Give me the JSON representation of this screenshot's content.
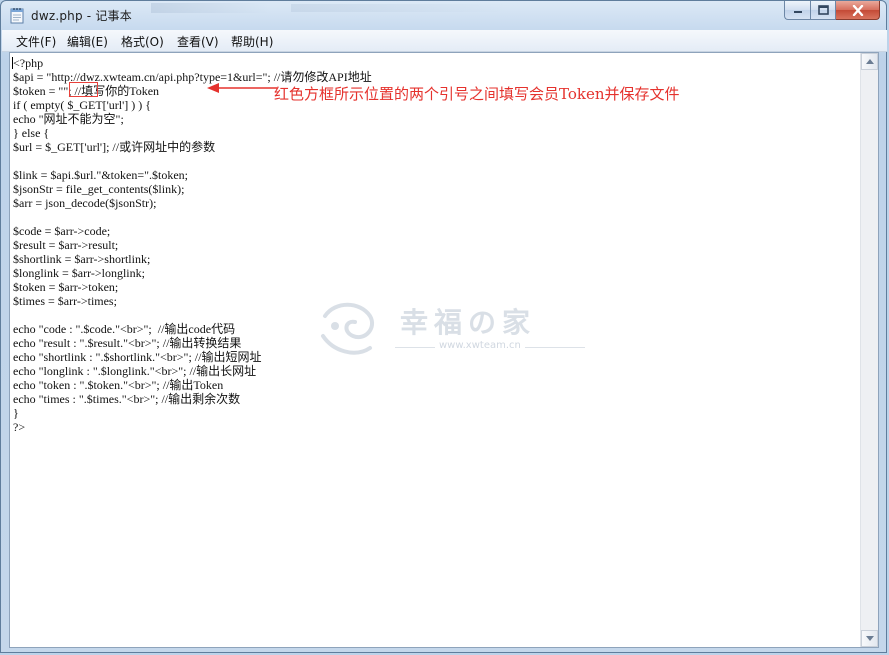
{
  "window": {
    "title": "dwz.php - 记事本"
  },
  "menu": [
    "文件(F)",
    "编辑(E)",
    "格式(O)",
    "查看(V)",
    "帮助(H)"
  ],
  "code_lines": [
    "<?php",
    "$api = \"http://dwz.xwteam.cn/api.php?type=1&url=\"; //请勿修改API地址",
    "$token = \"\"; //填写你的Token",
    "if ( empty( $_GET['url'] ) ) {",
    "echo \"网址不能为空\";",
    "} else {",
    "$url = $_GET['url']; //或许网址中的参数",
    "",
    "$link = $api.$url.\"&token=\".$token;",
    "$jsonStr = file_get_contents($link);",
    "$arr = json_decode($jsonStr);",
    "",
    "$code = $arr->code;",
    "$result = $arr->result;",
    "$shortlink = $arr->shortlink;",
    "$longlink = $arr->longlink;",
    "$token = $arr->token;",
    "$times = $arr->times;",
    "",
    "echo \"code : \".$code.\"<br>\";  //输出code代码",
    "echo \"result : \".$result.\"<br>\"; //输出转换结果",
    "echo \"shortlink : \".$shortlink.\"<br>\"; //输出短网址",
    "echo \"longlink : \".$longlink.\"<br>\"; //输出长网址",
    "echo \"token : \".$token.\"<br>\"; //输出Token",
    "echo \"times : \".$times.\"<br>\"; //输出剩余次数",
    "}",
    "?>"
  ],
  "annotation": {
    "text": "红色方框所示位置的两个引号之间填写会员Token并保存文件",
    "color": "#e5322d"
  },
  "watermark": {
    "brand": "幸福の家",
    "url": "www.xwteam.cn"
  },
  "icons": {
    "app": "notepad-icon",
    "minimize": "minimize-icon",
    "maximize": "maximize-icon",
    "close": "close-icon",
    "scroll_up": "chevron-up-icon",
    "scroll_down": "chevron-down-icon"
  }
}
